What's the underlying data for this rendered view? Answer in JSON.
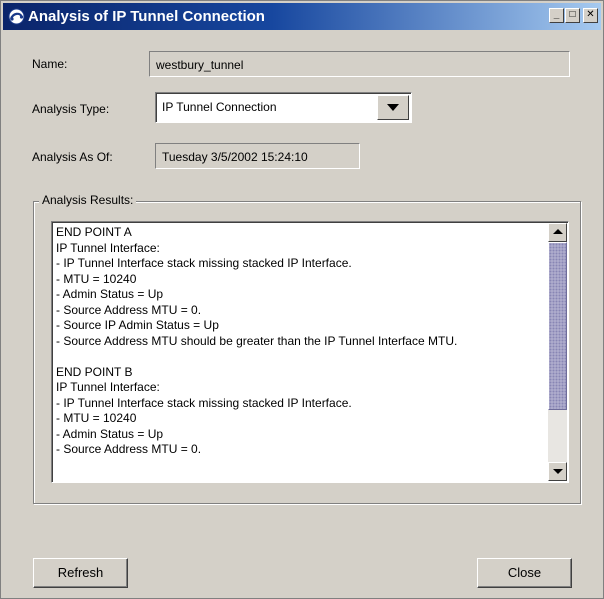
{
  "window": {
    "title": "Analysis of IP Tunnel Connection",
    "controls": {
      "minimize": "_",
      "maximize": "□",
      "close": "✕"
    }
  },
  "form": {
    "name_label": "Name:",
    "name_value": "westbury_tunnel",
    "analysis_type_label": "Analysis Type:",
    "analysis_type_value": "IP Tunnel Connection",
    "analysis_as_of_label": "Analysis As Of:",
    "analysis_as_of_value": "Tuesday 3/5/2002 15:24:10"
  },
  "results": {
    "group_label": "Analysis Results:",
    "lines": [
      "END POINT A",
      "IP Tunnel Interface:",
      "- IP Tunnel Interface stack missing stacked IP Interface.",
      "- MTU = 10240",
      "- Admin Status = Up",
      "- Source Address MTU = 0.",
      "- Source IP Admin Status = Up",
      "- Source Address MTU should be greater than the IP Tunnel Interface MTU.",
      "",
      "END POINT B",
      "IP Tunnel Interface:",
      "- IP Tunnel Interface stack missing stacked IP Interface.",
      "- MTU = 10240",
      "- Admin Status = Up",
      "- Source Address MTU = 0."
    ]
  },
  "buttons": {
    "refresh": "Refresh",
    "close": "Close"
  },
  "colors": {
    "titlebar_start": "#0a246a",
    "titlebar_end": "#a6caf0",
    "window_bg": "#d4d0c8"
  },
  "icons": [
    "app-icon",
    "minimize-icon",
    "maximize-icon",
    "close-icon",
    "dropdown-arrow-icon",
    "scroll-up-icon",
    "scroll-down-icon"
  ]
}
